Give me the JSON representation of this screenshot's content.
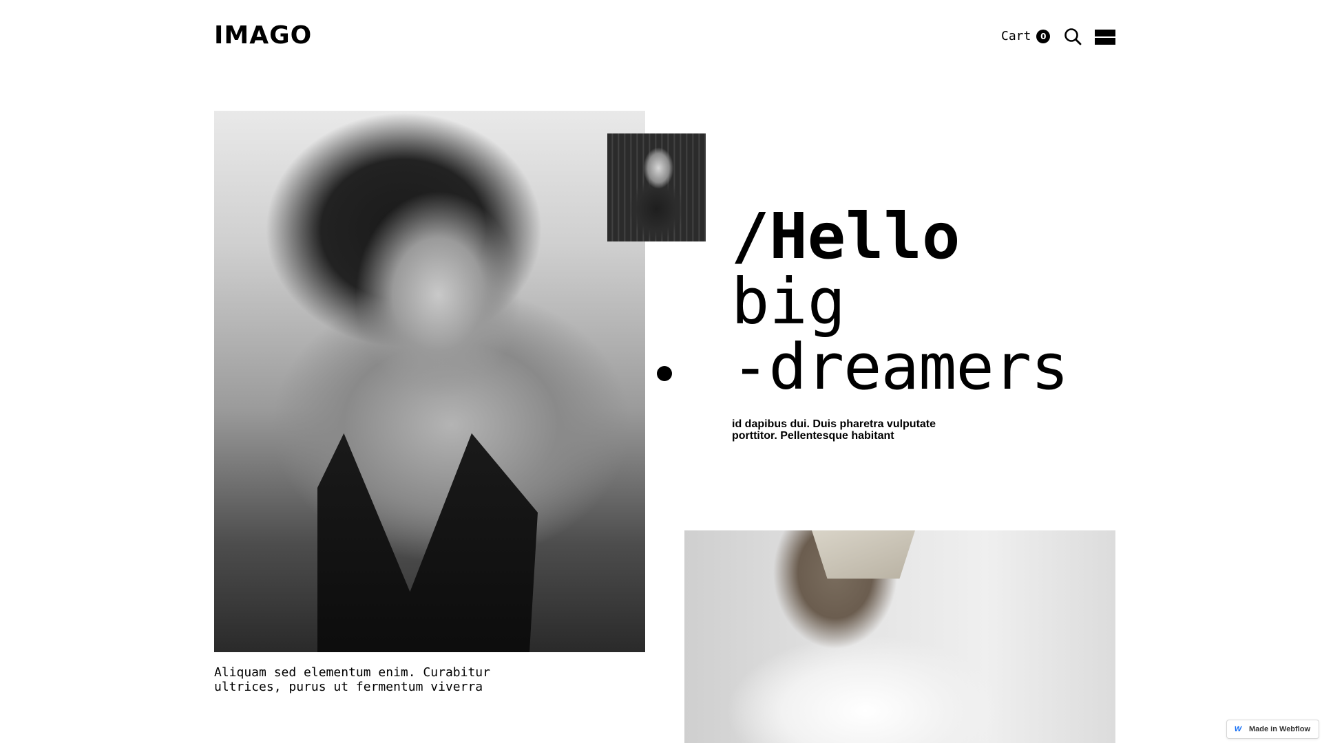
{
  "header": {
    "logo": "IMAGO",
    "cart": {
      "label": "Cart",
      "count": "0"
    },
    "icons": {
      "search": "search-icon",
      "menu": "hamburger-menu-icon"
    }
  },
  "hero": {
    "line1": "/Hello",
    "line2": "big",
    "line3": "-dreamers",
    "description": "id dapibus dui. Duis pharetra vulputate porttitor. Pellentesque habitant"
  },
  "caption": "Aliquam sed elementum enim. Curabitur ultrices, purus ut fermentum viverra",
  "badge": {
    "label": "Made in Webflow",
    "logo": "W"
  },
  "colors": {
    "text": "#000000",
    "background": "#ffffff",
    "webflow_blue": "#146ef5"
  }
}
